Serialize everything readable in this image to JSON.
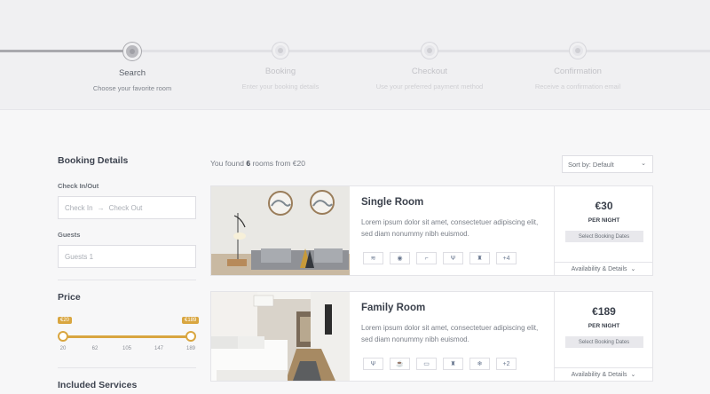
{
  "steps": [
    {
      "title": "Search",
      "subtitle": "Choose your favorite room"
    },
    {
      "title": "Booking",
      "subtitle": "Enter your booking details"
    },
    {
      "title": "Checkout",
      "subtitle": "Use your preferred payment method"
    },
    {
      "title": "Confirmation",
      "subtitle": "Receive a confirmation email"
    }
  ],
  "sidebar": {
    "title": "Booking Details",
    "checkinout_label": "Check In/Out",
    "checkin_placeholder": "Check In",
    "arrow": "→",
    "checkout_placeholder": "Check Out",
    "guests_label": "Guests",
    "guests_value": "Guests 1",
    "price_title": "Price",
    "price_min_tip": "€20",
    "price_max_tip": "€189",
    "price_ticks": [
      "20",
      "62",
      "105",
      "147",
      "189"
    ],
    "services_title": "Included Services"
  },
  "results": {
    "found_prefix": "You found ",
    "found_count": "6",
    "found_suffix": " rooms from €20",
    "sort_label": "Sort by: Default",
    "sort_chevron": "⌄"
  },
  "rooms": [
    {
      "name": "Single Room",
      "description": "Lorem ipsum dolor sit amet, consectetuer adipiscing elit, sed diam nonummy nibh euismod.",
      "amenities": [
        "wifi-icon",
        "eye-icon",
        "bath-icon",
        "restaurant-icon",
        "bottle-icon"
      ],
      "amenity_glyphs": [
        "≋",
        "◉",
        "⌐",
        "Ψ",
        "♜"
      ],
      "more": "+4",
      "price": "€30",
      "per": "PER NIGHT",
      "select_label": "Select Booking Dates",
      "availability_label": "Availability & Details",
      "chevron": "⌄"
    },
    {
      "name": "Family Room",
      "description": "Lorem ipsum dolor sit amet, consectetuer adipiscing elit, sed diam nonummy nibh euismod.",
      "amenities": [
        "restaurant-icon",
        "coffee-icon",
        "tv-icon",
        "bottle-icon",
        "snowflake-icon"
      ],
      "amenity_glyphs": [
        "Ψ",
        "☕",
        "▭",
        "♜",
        "❄"
      ],
      "more": "+2",
      "price": "€189",
      "per": "PER NIGHT",
      "select_label": "Select Booking Dates",
      "availability_label": "Availability & Details",
      "chevron": "⌄"
    }
  ],
  "colors": {
    "accent": "#d9a640",
    "brand_text": "#3a404b"
  }
}
